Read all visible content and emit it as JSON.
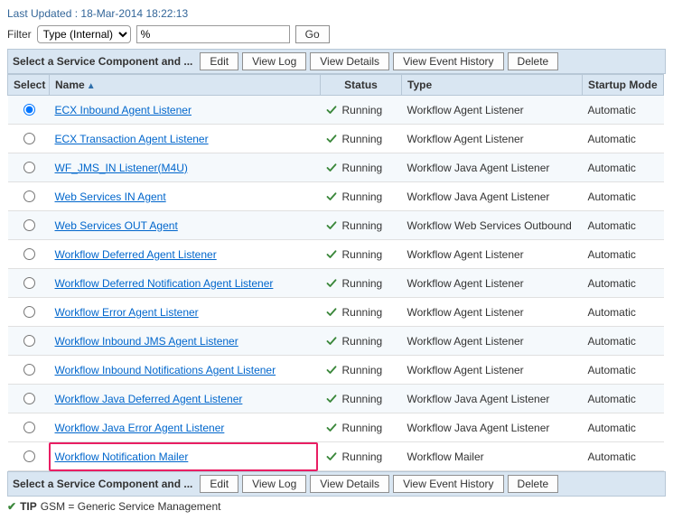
{
  "timestamp_label": "Last Updated :",
  "timestamp_value": "18-Mar-2014 18:22:13",
  "filter": {
    "label": "Filter",
    "type_selected": "Type (Internal)",
    "input_value": "%",
    "go_label": "Go"
  },
  "instruction": "Select a Service Component and ...",
  "actions": {
    "edit": "Edit",
    "view_log": "View Log",
    "view_details": "View Details",
    "view_event_history": "View Event History",
    "delete": "Delete"
  },
  "columns": {
    "select": "Select",
    "name": "Name",
    "status": "Status",
    "type": "Type",
    "startup_mode": "Startup Mode"
  },
  "rows": [
    {
      "name": "ECX Inbound Agent Listener",
      "status": "Running",
      "type": "Workflow Agent Listener",
      "mode": "Automatic",
      "selected": true,
      "highlight": false
    },
    {
      "name": "ECX Transaction Agent Listener",
      "status": "Running",
      "type": "Workflow Agent Listener",
      "mode": "Automatic",
      "selected": false,
      "highlight": false
    },
    {
      "name": "WF_JMS_IN Listener(M4U)",
      "status": "Running",
      "type": "Workflow Java Agent Listener",
      "mode": "Automatic",
      "selected": false,
      "highlight": false
    },
    {
      "name": "Web Services IN Agent",
      "status": "Running",
      "type": "Workflow Java Agent Listener",
      "mode": "Automatic",
      "selected": false,
      "highlight": false
    },
    {
      "name": "Web Services OUT Agent",
      "status": "Running",
      "type": "Workflow Web Services Outbound",
      "mode": "Automatic",
      "selected": false,
      "highlight": false
    },
    {
      "name": "Workflow Deferred Agent Listener",
      "status": "Running",
      "type": "Workflow Agent Listener",
      "mode": "Automatic",
      "selected": false,
      "highlight": false
    },
    {
      "name": "Workflow Deferred Notification Agent Listener",
      "status": "Running",
      "type": "Workflow Agent Listener",
      "mode": "Automatic",
      "selected": false,
      "highlight": false
    },
    {
      "name": "Workflow Error Agent Listener",
      "status": "Running",
      "type": "Workflow Agent Listener",
      "mode": "Automatic",
      "selected": false,
      "highlight": false
    },
    {
      "name": "Workflow Inbound JMS Agent Listener",
      "status": "Running",
      "type": "Workflow Agent Listener",
      "mode": "Automatic",
      "selected": false,
      "highlight": false
    },
    {
      "name": "Workflow Inbound Notifications Agent Listener",
      "status": "Running",
      "type": "Workflow Agent Listener",
      "mode": "Automatic",
      "selected": false,
      "highlight": false
    },
    {
      "name": "Workflow Java Deferred Agent Listener",
      "status": "Running",
      "type": "Workflow Java Agent Listener",
      "mode": "Automatic",
      "selected": false,
      "highlight": false
    },
    {
      "name": "Workflow Java Error Agent Listener",
      "status": "Running",
      "type": "Workflow Java Agent Listener",
      "mode": "Automatic",
      "selected": false,
      "highlight": false
    },
    {
      "name": "Workflow Notification Mailer",
      "status": "Running",
      "type": "Workflow Mailer",
      "mode": "Automatic",
      "selected": false,
      "highlight": true
    }
  ],
  "tip": {
    "label": "TIP",
    "text": "GSM = Generic Service Management"
  }
}
